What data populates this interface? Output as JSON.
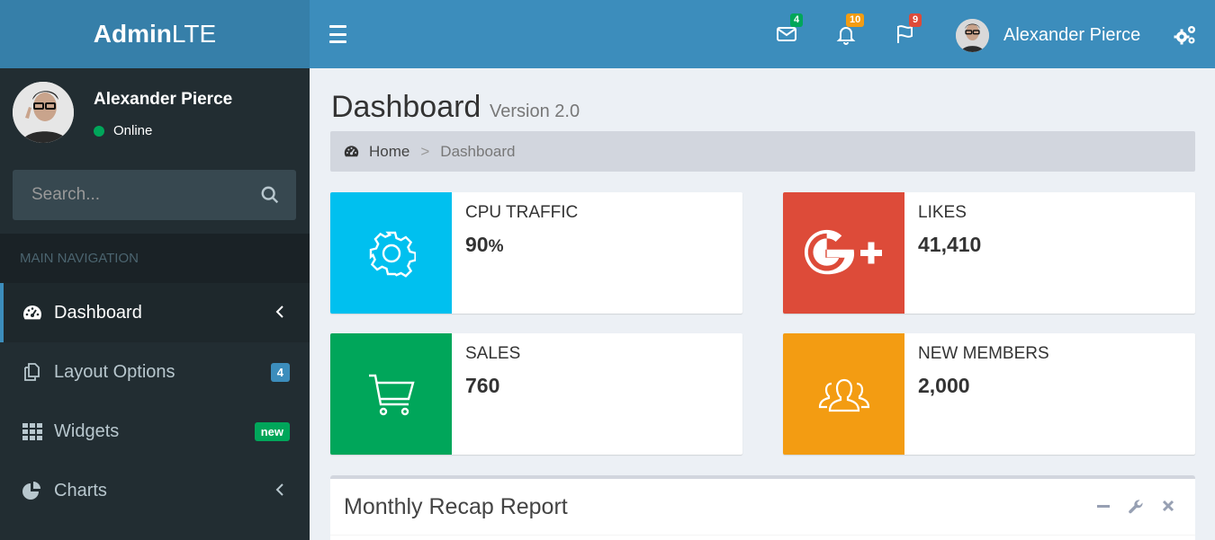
{
  "logo": {
    "bold": "Admin",
    "light": "LTE"
  },
  "header": {
    "messages_count": "4",
    "notifications_count": "10",
    "tasks_count": "9",
    "user_name": "Alexander Pierce",
    "colors": {
      "messages_badge": "#00a65a",
      "notifications_badge": "#f39c12",
      "tasks_badge": "#dd4b39"
    }
  },
  "sidebar": {
    "user": {
      "name": "Alexander Pierce",
      "status": "Online"
    },
    "search": {
      "placeholder": "Search..."
    },
    "nav_header": "MAIN NAVIGATION",
    "items": [
      {
        "label": "Dashboard",
        "icon": "dashboard-icon",
        "active": true
      },
      {
        "label": "Layout Options",
        "icon": "files-icon",
        "badge": "4",
        "badge_color": "#3c8dbc"
      },
      {
        "label": "Widgets",
        "icon": "th-icon",
        "badge": "new",
        "badge_color": "#00a65a"
      },
      {
        "label": "Charts",
        "icon": "pie-chart-icon"
      }
    ]
  },
  "content": {
    "title": "Dashboard",
    "subtitle": "Version 2.0",
    "breadcrumb": {
      "home": "Home",
      "separator": ">",
      "current": "Dashboard"
    },
    "info_boxes": [
      {
        "text": "CPU TRAFFIC",
        "number": "90",
        "unit": "%",
        "color": "#00c0ef",
        "icon": "gear-icon"
      },
      {
        "text": "LIKES",
        "number": "41,410",
        "color": "#dd4b39",
        "icon": "google-plus-icon"
      },
      {
        "text": "SALES",
        "number": "760",
        "color": "#00a65a",
        "icon": "shopping-cart-icon"
      },
      {
        "text": "NEW MEMBERS",
        "number": "2,000",
        "color": "#f39c12",
        "icon": "users-icon"
      }
    ],
    "report": {
      "title": "Monthly Recap Report"
    }
  }
}
